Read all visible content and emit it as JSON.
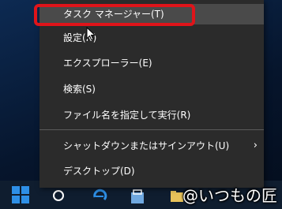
{
  "context_menu": {
    "items": [
      {
        "label": "タスク マネージャー(T)"
      },
      {
        "label": "設定(N)"
      },
      {
        "label": "エクスプローラー(E)"
      },
      {
        "label": "検索(S)"
      },
      {
        "label": "ファイル名を指定して実行(R)"
      },
      {
        "label": "シャットダウンまたはサインアウト(U)",
        "submenu_glyph": "›"
      },
      {
        "label": "デスクトップ(D)"
      }
    ]
  },
  "watermark": "@いつもの匠",
  "colors": {
    "menu_background": "#2b2b2b",
    "highlight_border": "#e0141a",
    "windows_logo": "#2e8fe6",
    "taskbar": "#0f1d2f"
  }
}
